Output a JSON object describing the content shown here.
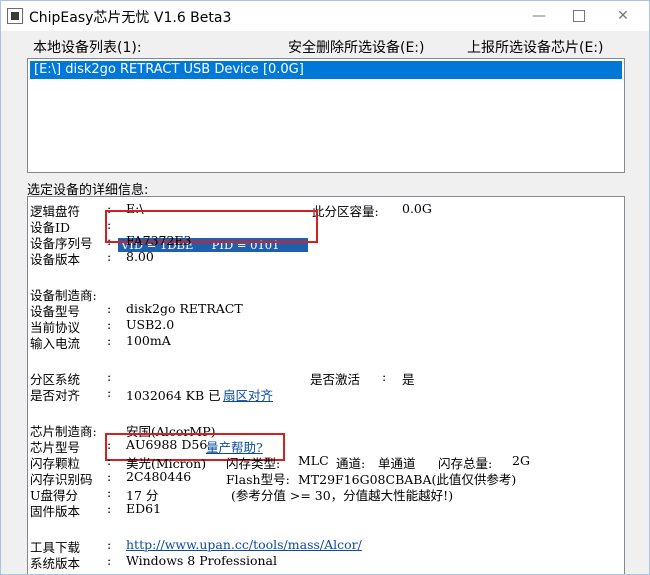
{
  "window": {
    "title": "ChipEasy芯片无忧 V1.6 Beta3",
    "minimize_glyph": "—",
    "close_glyph": "✕"
  },
  "top": {
    "local_devices_label": "本地设备列表(1):",
    "safe_remove_label": "安全删除所选设备(E:)",
    "report_chip_label": "上报所选设备芯片(E:)"
  },
  "device_list": {
    "items": [
      "[E:\\] disk2go RETRACT USB Device [0.0G]"
    ]
  },
  "details": {
    "label": "选定设备的详细信息:",
    "rows": {
      "logical_drive": {
        "key": "逻辑盘符",
        "value": "E:\\"
      },
      "partition_capacity": {
        "key": "此分区容量:",
        "value": "0.0G"
      },
      "device_id": {
        "key": "设备ID",
        "value": "VID = 1DBE     PID = 0101"
      },
      "serial": {
        "key": "设备序列号",
        "value": "FA7372E3"
      },
      "version": {
        "key": "设备版本",
        "value": "8.00"
      },
      "manufacturer": {
        "key": "设备制造商:",
        "value": ""
      },
      "model": {
        "key": "设备型号",
        "value": "disk2go RETRACT"
      },
      "protocol": {
        "key": "当前协议",
        "value": "USB2.0"
      },
      "current": {
        "key": "输入电流",
        "value": "100mA"
      },
      "partition_system": {
        "key": "分区系统",
        "value": ""
      },
      "activated": {
        "key": "是否激活",
        "value": "是"
      },
      "aligned": {
        "key": "是否对齐",
        "value": "1032064 KB 已",
        "link": "扇区对齐"
      },
      "chip_vendor": {
        "key": "芯片制造商:",
        "value": "安国(AlcorMP)"
      },
      "chip_model": {
        "key": "芯片型号",
        "value": "AU6988 D56",
        "link": "量产帮助?"
      },
      "flash_chip": {
        "key": "闪存颗粒",
        "value": "美光(Micron)"
      },
      "flash_type": {
        "key": "闪存类型:",
        "value": "MLC"
      },
      "channel": {
        "key": "通道:",
        "value": "单通道"
      },
      "flash_total": {
        "key": "闪存总量:",
        "value": "2G"
      },
      "flash_id": {
        "key": "闪存识别码",
        "value": "2C480446"
      },
      "flash_model": {
        "key": "Flash型号:",
        "value": "MT29F16G08CBABA(此值仅供参考)"
      },
      "score": {
        "key": "U盘得分",
        "value": "17 分",
        "note": "(参考分值 >= 30，分值越大性能越好!)"
      },
      "firmware": {
        "key": "固件版本",
        "value": "ED61"
      },
      "tool_download": {
        "key": "工具下载",
        "link": "http://www.upan.cc/tools/mass/Alcor/"
      },
      "os_version": {
        "key": "系统版本",
        "value": "Windows 8 Professional"
      }
    }
  },
  "colors": {
    "selection": "#0078d7",
    "highlight": "#1e5fb0",
    "annotation_box": "#d62020",
    "link": "#0b4aa3"
  }
}
